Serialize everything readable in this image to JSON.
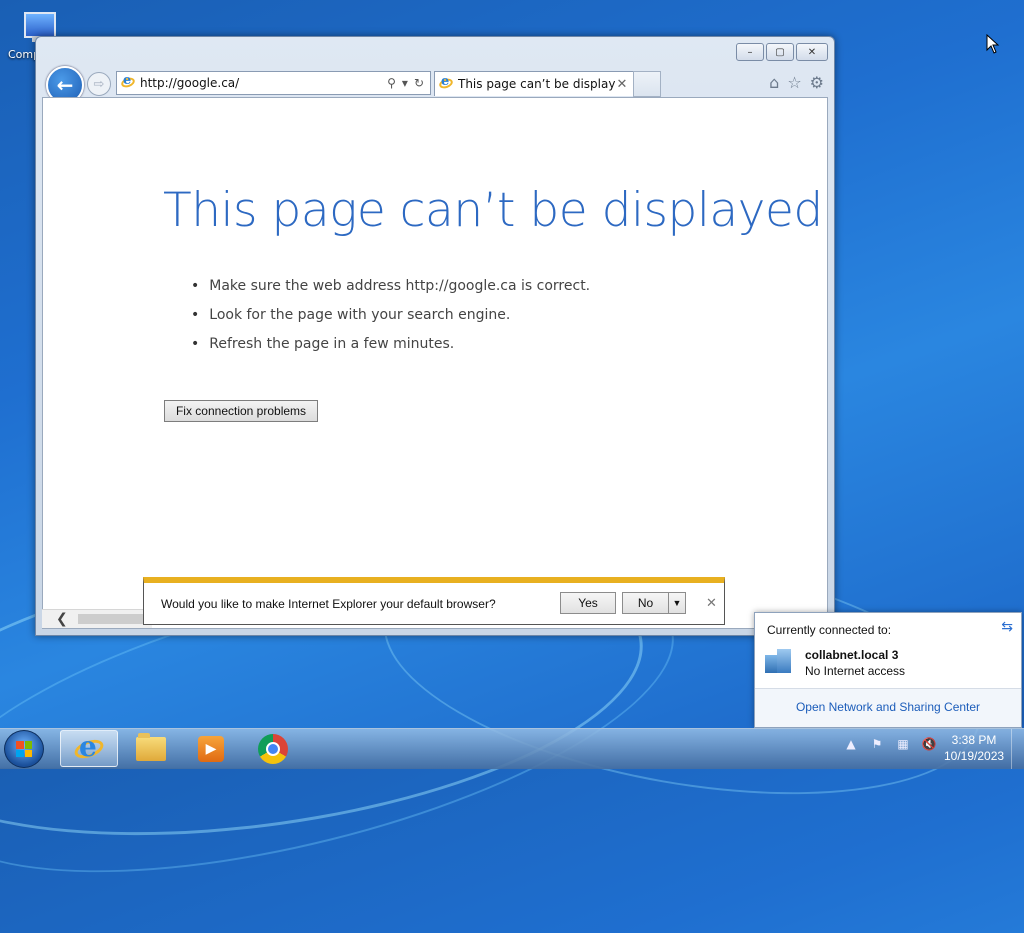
{
  "desktop": {
    "icon_label": "Comp"
  },
  "browser": {
    "address": "http://google.ca/",
    "tab_title": "This page can’t be displayed",
    "controls": {
      "minimize": "–",
      "maximize": "▢",
      "close": "✕"
    },
    "toolbar_icons": [
      "home-icon",
      "favorites-icon",
      "settings-icon"
    ],
    "address_icons": [
      "search-icon",
      "dropdown-icon",
      "refresh-icon"
    ]
  },
  "page": {
    "title": "This page can’t be displayed",
    "bullets": [
      "Make sure the web address http://google.ca is correct.",
      "Look for the page with your search engine.",
      "Refresh the page in a few minutes."
    ],
    "fix_button": "Fix connection problems"
  },
  "notification": {
    "text": "Would you like to make Internet Explorer your default browser?",
    "yes_label": "Yes",
    "no_label": "No",
    "accent_color": "#e8b020"
  },
  "network_popup": {
    "heading": "Currently connected to:",
    "network_name": "collabnet.local  3",
    "status": "No Internet access",
    "link": "Open Network and Sharing Center"
  },
  "taskbar": {
    "pinned": [
      "internet-explorer",
      "windows-explorer",
      "media-player",
      "google-chrome"
    ],
    "time": "3:38 PM",
    "date": "10/19/2023"
  },
  "colors": {
    "title_blue": "#2d69c2",
    "link_blue": "#1c5dba"
  }
}
